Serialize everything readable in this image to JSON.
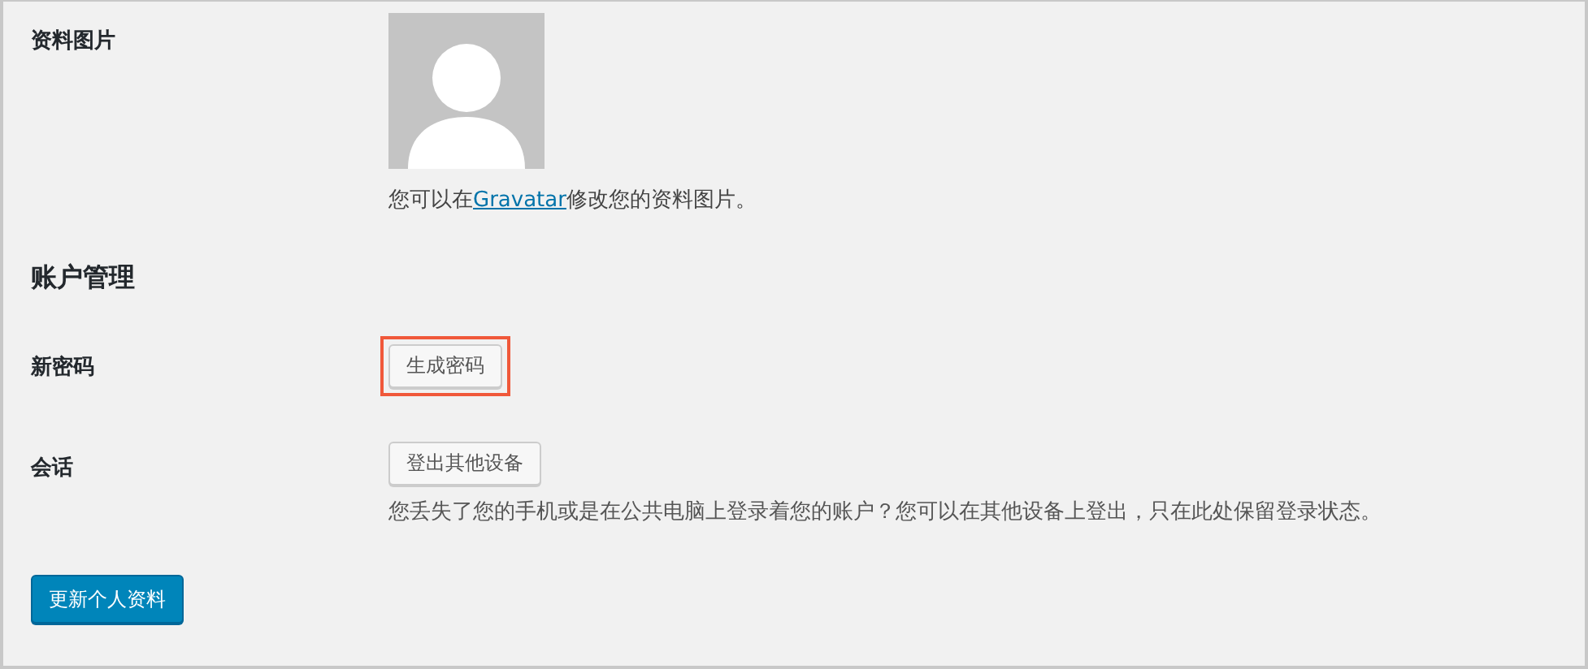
{
  "profile_picture": {
    "label": "资料图片",
    "avatar": {
      "kind": "placeholder"
    },
    "caption": {
      "before": "您可以在",
      "link": "Gravatar",
      "after": "修改您的资料图片。"
    }
  },
  "account_section": {
    "heading": "账户管理"
  },
  "rows": [
    {
      "label": "新密码",
      "button": "生成密码",
      "highlighted": true
    },
    {
      "label": "会话",
      "button": "登出其他设备",
      "highlighted": false,
      "description": "您丢失了您的手机或是在公共电脑上登录着您的账户？您可以在其他设备上登出，只在此处保留登录状态。"
    }
  ],
  "submit_button": "更新个人资料"
}
